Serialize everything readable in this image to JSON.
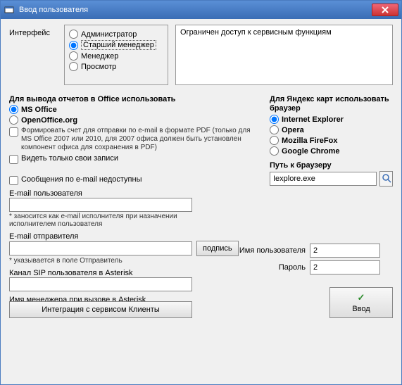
{
  "window": {
    "title": "Ввод пользователя"
  },
  "interface": {
    "label": "Интерфейс",
    "options": {
      "admin": "Администратор",
      "senior": "Старший менеджер",
      "manager": "Менеджер",
      "view": "Просмотр"
    },
    "selected": "senior",
    "description": "Ограничен доступ к сервисным функциям"
  },
  "office": {
    "heading": "Для вывода отчетов в Office использовать",
    "ms": "MS Office",
    "oo": "OpenOffice.org",
    "pdf_hint": "Формировать счет для отправки по e-mail в формате PDF (только для MS Office 2007 или 2010, для 2007 офиса должен быть установлен компонент офиса для  сохранения в PDF)",
    "own_records": "Видеть только свои записи",
    "email_unavailable": "Сообщения по e-mail недоступны"
  },
  "browser": {
    "heading": "Для Яндекс карт использовать браузер",
    "ie": "Internet Explorer",
    "opera": "Opera",
    "firefox": "Mozilla FireFox",
    "chrome": "Google Chrome",
    "path_label": "Путь к браузеру",
    "path_value": "Iexplore.exe"
  },
  "email": {
    "user_label": "E-mail пользователя",
    "user_value": "",
    "user_note": "* заносится как e-mail исполнителя при назначении исполнителем пользователя",
    "sender_label": "E-mail отправителя",
    "sender_value": "",
    "signature_btn": "подпись",
    "sender_note": "* указывается в поле Отправитель"
  },
  "auth": {
    "username_label": "Имя пользователя",
    "username_value": "2",
    "password_label": "Пароль",
    "password_value": "2"
  },
  "asterisk": {
    "sip_label": "Канал SIP пользователя в Asterisk",
    "sip_value": "",
    "mgr_label": "Имя менеджера при вызове в Asterisk",
    "mgr_value": ""
  },
  "footer": {
    "integrate": "Интеграция с сервисом Клиенты",
    "enter": "Ввод"
  }
}
